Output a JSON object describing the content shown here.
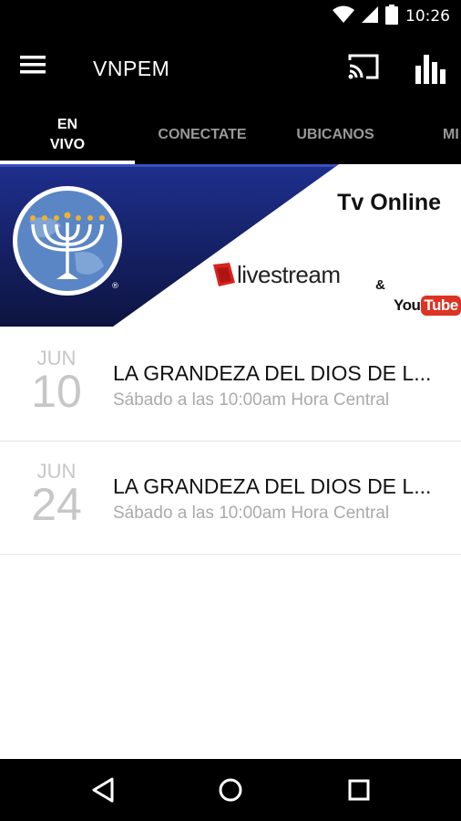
{
  "status_bar": {
    "time": "10:26",
    "icons": [
      "wifi-icon",
      "signal-icon",
      "battery-icon"
    ]
  },
  "app_bar": {
    "title": "VNPEM",
    "icons": [
      "menu-icon",
      "cast-icon",
      "bar-chart-icon"
    ]
  },
  "tabs": [
    {
      "label": "EN VIVO",
      "line1": "EN",
      "line2": "VIVO",
      "active": true
    },
    {
      "label": "CONECTATE",
      "active": false
    },
    {
      "label": "UBICANOS",
      "active": false
    },
    {
      "label": "MI",
      "active": false
    }
  ],
  "banner": {
    "title": "Tv Online",
    "livestream": "livestream",
    "ampersand": "&",
    "youtube_you": "You",
    "youtube_tube": "Tube",
    "logo_mark": "®",
    "colors": {
      "blue": "#1e2f8e",
      "blue_dark": "#0d1440",
      "red": "#d32",
      "yellow": "#f2b12a"
    }
  },
  "events": [
    {
      "month": "JUN",
      "day": "10",
      "title": "LA GRANDEZA DEL DIOS DE L...",
      "subtitle": "Sábado a las 10:00am Hora Central"
    },
    {
      "month": "JUN",
      "day": "24",
      "title": "LA GRANDEZA DEL DIOS DE L...",
      "subtitle": "Sábado a las 10:00am Hora Central"
    }
  ],
  "nav_bar": {
    "icons": [
      "back-icon",
      "home-icon",
      "recents-icon"
    ]
  }
}
